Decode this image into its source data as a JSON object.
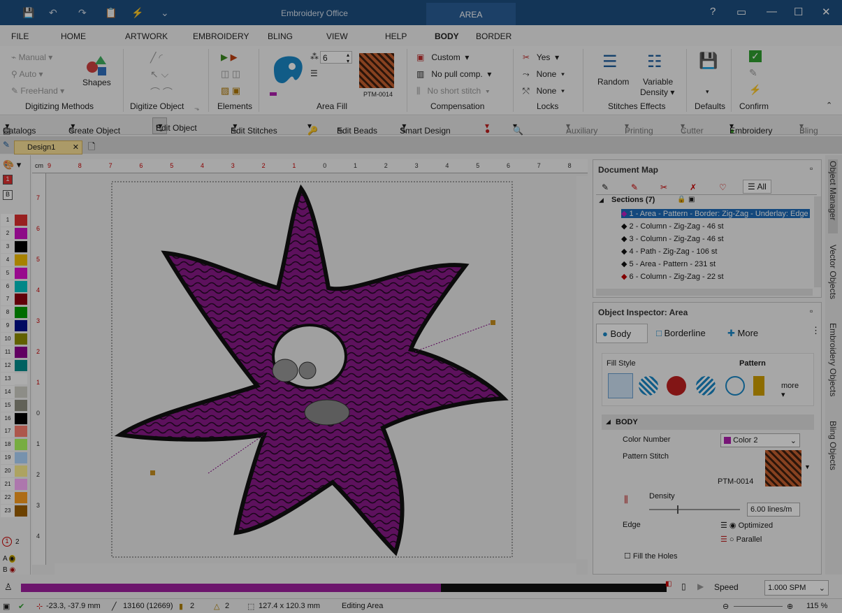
{
  "title_bar": {
    "app_title": "Embroidery Office",
    "context_tab": "AREA",
    "help": "?"
  },
  "menu": [
    "FILE",
    "HOME",
    "ARTWORK",
    "EMBROIDERY",
    "BLING",
    "VIEW",
    "HELP",
    "BODY",
    "BORDER"
  ],
  "ribbon": {
    "digitizing": {
      "manual": "Manual",
      "auto": "Auto",
      "freehand": "FreeHand",
      "shapes": "Shapes",
      "group": "Digitizing Methods"
    },
    "digitize_object": {
      "group": "Digitize Object"
    },
    "elements": {
      "group": "Elements"
    },
    "area_fill": {
      "value": "6",
      "pattern": "PTM-0014",
      "group": "Area Fill"
    },
    "compensation": {
      "custom": "Custom",
      "pull": "No pull comp.",
      "short": "No short stitch",
      "group": "Compensation"
    },
    "locks": {
      "yes": "Yes",
      "none1": "None",
      "none2": "None",
      "group": "Locks"
    },
    "effects": {
      "random": "Random",
      "variable1": "Variable",
      "variable2": "Density",
      "group": "Stitches Effects"
    },
    "defaults": {
      "group": "Defaults"
    },
    "confirm": {
      "group": "Confirm"
    }
  },
  "toolbar": {
    "catalogs": "Catalogs",
    "create": "Create Object",
    "edit": "Edit Object",
    "stitches": "Edit Stitches",
    "beads": "Edit Beads",
    "smart": "Smart Design",
    "auxiliary": "Auxiliary",
    "printing": "Printing",
    "cutter": "Cutter",
    "embroidery": "Embroidery",
    "bling": "Bling"
  },
  "doc_tab": "Design1",
  "palette": {
    "dropdown1": "1",
    "dropdown2": "B",
    "footer_num": "2",
    "colors": [
      {
        "n": "1",
        "c": "#e03030"
      },
      {
        "n": "2",
        "c": "#d010c8"
      },
      {
        "n": "3",
        "c": "#000000"
      },
      {
        "n": "4",
        "c": "#f7c000"
      },
      {
        "n": "5",
        "c": "#e010d0"
      },
      {
        "n": "6",
        "c": "#00c8c8"
      },
      {
        "n": "7",
        "c": "#900010"
      },
      {
        "n": "8",
        "c": "#00a000"
      },
      {
        "n": "9",
        "c": "#001090"
      },
      {
        "n": "10",
        "c": "#909000"
      },
      {
        "n": "11",
        "c": "#900090"
      },
      {
        "n": "12",
        "c": "#009090"
      },
      {
        "n": "13",
        "c": "#ffffff"
      },
      {
        "n": "14",
        "c": "#d0d0c8"
      },
      {
        "n": "15",
        "c": "#909080"
      },
      {
        "n": "16",
        "c": "#000000"
      },
      {
        "n": "17",
        "c": "#ff8070"
      },
      {
        "n": "18",
        "c": "#b0ff60"
      },
      {
        "n": "19",
        "c": "#b0d8ff"
      },
      {
        "n": "20",
        "c": "#fff090"
      },
      {
        "n": "21",
        "c": "#ffb0ff"
      },
      {
        "n": "22",
        "c": "#ffa020"
      },
      {
        "n": "23",
        "c": "#a06000"
      }
    ]
  },
  "ruler": {
    "unit": "cm",
    "h_ticks": [
      "9",
      "8",
      "7",
      "6",
      "5",
      "4",
      "3",
      "2",
      "1",
      "0",
      "1",
      "2",
      "3",
      "4",
      "5",
      "6",
      "7",
      "8"
    ],
    "v_ticks": [
      "7",
      "6",
      "5",
      "4",
      "3",
      "2",
      "1",
      "0",
      "1",
      "2",
      "3",
      "4"
    ]
  },
  "document_map": {
    "title": "Document Map",
    "tab_all": "All",
    "sections": "Sections (7)",
    "items": [
      {
        "label": "1 - Area - Pattern - Border: Zig-Zag - Underlay: Edge",
        "color": "#c020c0"
      },
      {
        "label": "2 - Column - Zig-Zag - 46 st",
        "color": "#111"
      },
      {
        "label": "3 - Column - Zig-Zag - 46 st",
        "color": "#111"
      },
      {
        "label": "4 - Path - Zig-Zag - 106 st",
        "color": "#111"
      },
      {
        "label": "5 - Area - Pattern - 231 st",
        "color": "#111"
      },
      {
        "label": "6 - Column - Zig-Zag - 22 st",
        "color": "#c00000"
      }
    ]
  },
  "inspector": {
    "title": "Object Inspector: Area",
    "tabs": [
      "Body",
      "Borderline",
      "More"
    ],
    "fill_style": "Fill Style",
    "fill_value": "Pattern",
    "more": "more",
    "section": "BODY",
    "color_number": "Color Number",
    "color_value": "Color 2",
    "pattern_stitch": "Pattern Stitch",
    "pattern_code": "PTM-0014",
    "density": "Density",
    "density_value": "6.00 lines/m",
    "edge": "Edge",
    "edge_opt1": "Optimized",
    "edge_opt2": "Parallel",
    "fill_holes": "Fill the Holes"
  },
  "side_tabs": [
    "Object Manager",
    "Vector Objects",
    "Embroidery Objects",
    "Bling Objects"
  ],
  "playback": {
    "speed_label": "Speed",
    "speed_value": "1.000 SPM",
    "progress": 0.65
  },
  "status": {
    "coords": "-23.3, -37.9 mm",
    "stitches": "13160 (12669)",
    "colors": "2",
    "trims": "2",
    "size": "127.4 x 120.3 mm",
    "mode": "Editing Area",
    "zoom": "115 %"
  },
  "colors": {
    "accent": "#1d4e80",
    "star": "#8a1a8a"
  }
}
